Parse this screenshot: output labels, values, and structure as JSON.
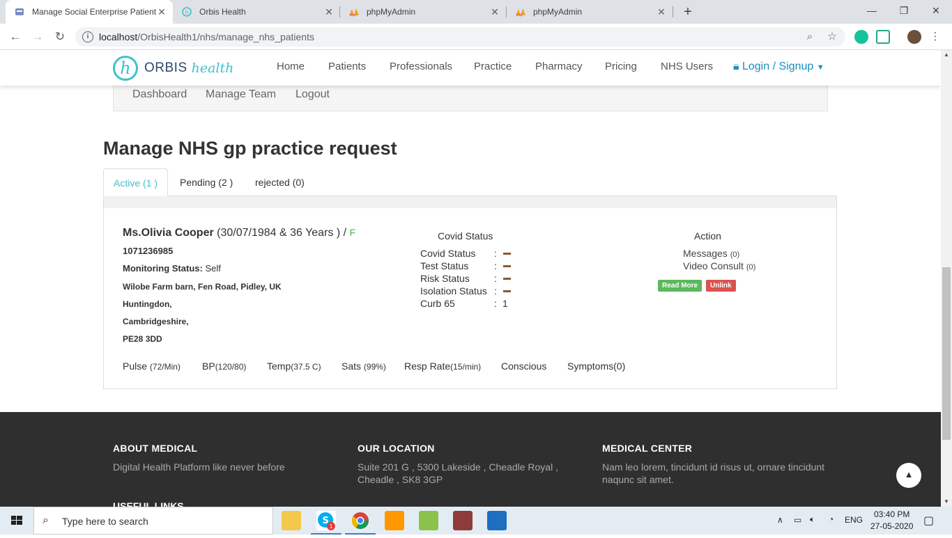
{
  "browser": {
    "tabs": [
      {
        "title": "Manage Social Enterprise Patient",
        "active": true
      },
      {
        "title": "Orbis Health",
        "active": false
      },
      {
        "title": "phpMyAdmin",
        "active": false
      },
      {
        "title": "phpMyAdmin",
        "active": false
      }
    ],
    "url_host": "localhost",
    "url_path": "/OrbisHealth1/nhs/manage_nhs_patients"
  },
  "header": {
    "logo_text_1": "ORBIS",
    "logo_text_2": "health",
    "nav": [
      "Home",
      "Patients",
      "Professionals",
      "Practice",
      "Pharmacy",
      "Pricing",
      "NHS Users"
    ],
    "login_label": "Login / Signup"
  },
  "subnav": [
    "Dashboard",
    "Manage Team",
    "Logout"
  ],
  "main": {
    "title": "Manage NHS gp practice request",
    "tabs": [
      "Active (1 )",
      "Pending (2 )",
      "rejected (0)"
    ]
  },
  "patient": {
    "name": "Ms.Olivia Cooper",
    "dob_age": "(30/07/1984 & 36 Years ) /",
    "sex": "F",
    "nhs_number": "1071236985",
    "monitoring_label": "Monitoring Status:",
    "monitoring_value": "Self",
    "address": [
      "Wilobe Farm barn, Fen Road, Pidley, UK",
      "Huntingdon,",
      "Cambridgeshire,",
      "PE28 3DD"
    ]
  },
  "covid": {
    "title": "Covid Status",
    "rows": [
      {
        "label": "Covid Status",
        "sep": ":",
        "value": ""
      },
      {
        "label": "Test Status",
        "sep": ":",
        "value": ""
      },
      {
        "label": "Risk Status",
        "sep": ":",
        "value": ""
      },
      {
        "label": "Isolation Status",
        "sep": ":",
        "value": ""
      },
      {
        "label": "Curb 65",
        "sep": ":",
        "value": "1"
      }
    ]
  },
  "action": {
    "title": "Action",
    "messages_label": "Messages",
    "messages_count": "(0)",
    "video_label": "Video Consult",
    "video_count": "(0)",
    "read_more": "Read More",
    "unlink": "Unlink"
  },
  "vitals": [
    {
      "label": "Pulse",
      "value": "(72/Min)"
    },
    {
      "label": "BP",
      "value": "(120/80)"
    },
    {
      "label": "Temp",
      "value": "(37.5 C)"
    },
    {
      "label": "Sats",
      "value": "(99%)"
    },
    {
      "label": "Resp Rate",
      "value": "(15/min)"
    },
    {
      "label": "Conscious",
      "value": ""
    },
    {
      "label": "Symptoms(0)",
      "value": ""
    }
  ],
  "footer": {
    "about_title": "ABOUT MEDICAL",
    "about_text": "Digital Health Platform like never before",
    "location_title": "OUR LOCATION",
    "location_text": "Suite 201 G , 5300 Lakeside , Cheadle Royal , Cheadle , SK8 3GP",
    "center_title": "MEDICAL CENTER",
    "center_text": "Nam leo lorem, tincidunt id risus ut, ornare tincidunt naqunc sit amet.",
    "useful_links": "USEFUL LINKS"
  },
  "taskbar": {
    "search_placeholder": "Type here to search",
    "language": "ENG",
    "time": "03:40 PM",
    "date": "27-05-2020",
    "skype_badge": "1"
  },
  "colors": {
    "accent": "#3fc1c9",
    "login": "#1a8fbf",
    "read_more": "#5cb85c",
    "unlink": "#d9534f",
    "footer_bg": "#2f2f2f",
    "status_dash": "#8b5a2b"
  }
}
